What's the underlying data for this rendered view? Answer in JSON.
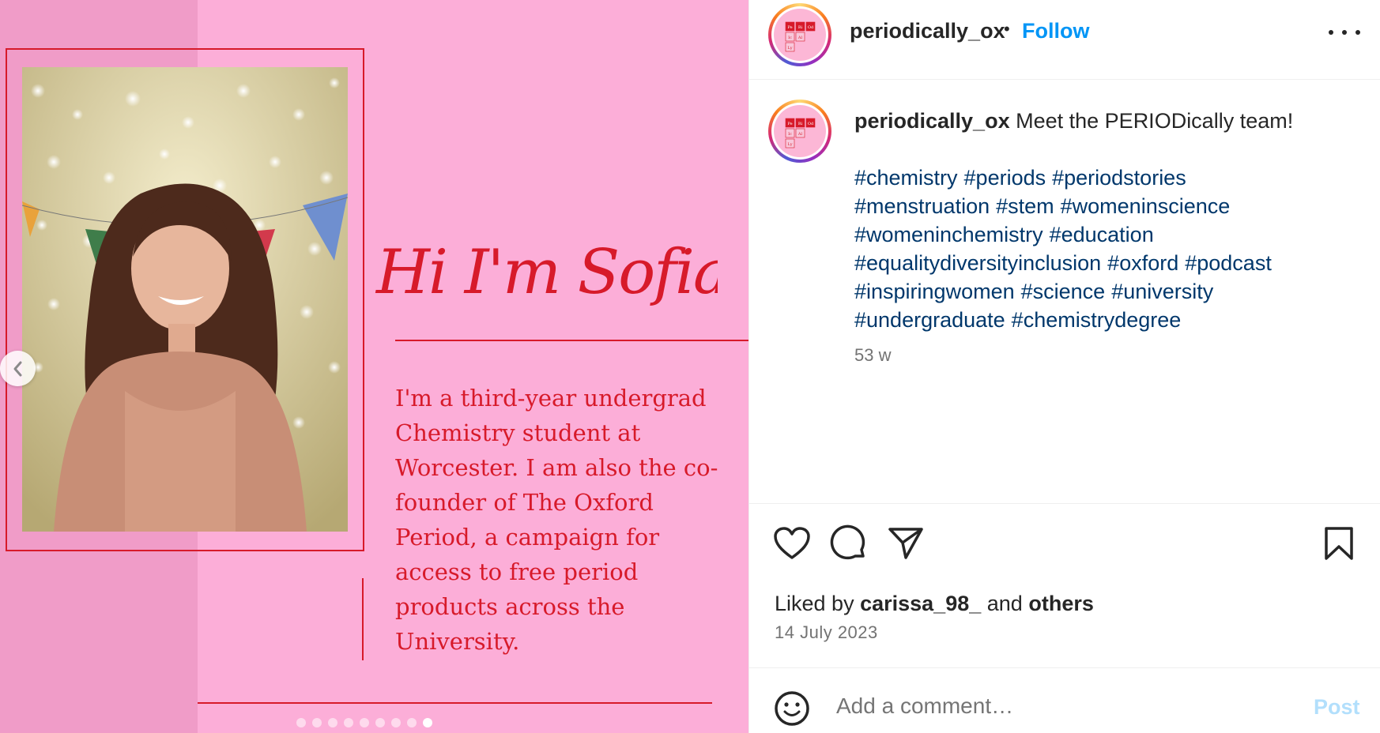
{
  "media": {
    "headline": "Hi I'm Sofia!",
    "bio": "I'm a third-year undergrad Chemistry student at Worcester. I am also the co-founder of The Oxford Period, a campaign for access to free period products across the University.",
    "slide_count": 9,
    "active_slide": 9,
    "colors": {
      "background": "#fcaed8",
      "accent": "#d71a2a",
      "band": "#f09cc8"
    }
  },
  "header": {
    "username": "periodically_ox",
    "separator": "•",
    "follow_label": "Follow"
  },
  "caption": {
    "username": "periodically_ox",
    "text": "Meet the PERIODically team!",
    "hashtags": [
      "#chemistry",
      "#periods",
      "#periodstories",
      "#menstruation",
      "#stem",
      "#womeninscience",
      "#womeninchemistry",
      "#education",
      "#equalitydiversityinclusion",
      "#oxford",
      "#podcast",
      "#inspiringwomen",
      "#science",
      "#university",
      "#undergraduate",
      "#chemistrydegree"
    ],
    "age": "53 w"
  },
  "logo_cells": [
    "Pe",
    "Ri",
    "Od",
    "Ic",
    "Al",
    "Ly"
  ],
  "actions": {
    "icons": [
      "heart-icon",
      "comment-icon",
      "share-icon",
      "bookmark-icon"
    ]
  },
  "likes": {
    "prefix": "Liked by",
    "user": "carissa_98_",
    "joiner": "and",
    "others": "others"
  },
  "date": "14 July 2023",
  "comment": {
    "placeholder": "Add a comment…",
    "post_label": "Post"
  }
}
